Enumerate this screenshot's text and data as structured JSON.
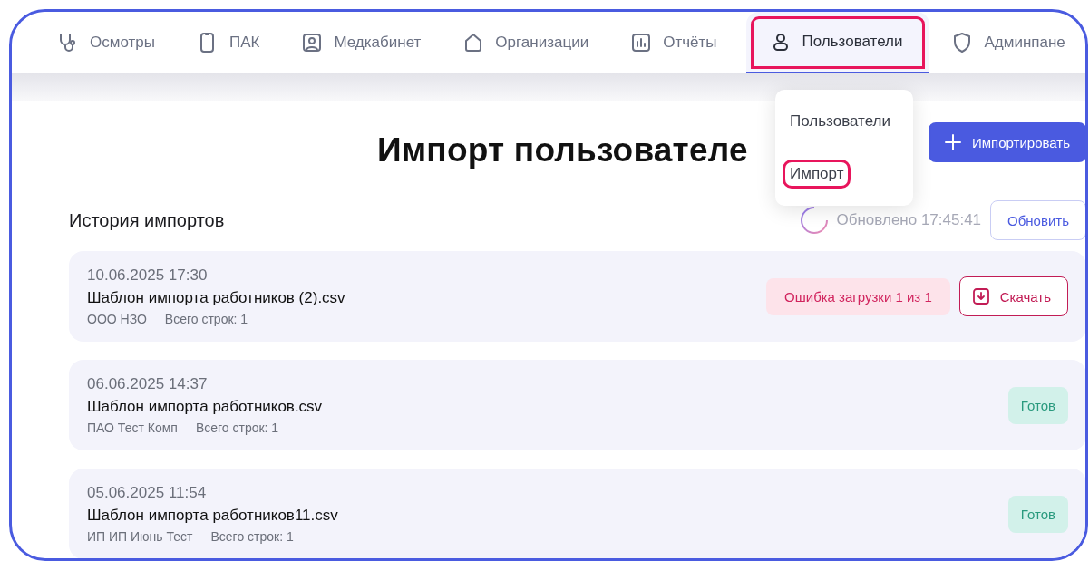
{
  "nav": {
    "items": [
      {
        "label": "Осмотры",
        "kind": "stethoscope",
        "selected": false,
        "highlighted": false
      },
      {
        "label": "ПАК",
        "kind": "device",
        "selected": false,
        "highlighted": false
      },
      {
        "label": "Медкабинет",
        "kind": "portrait",
        "selected": false,
        "highlighted": false
      },
      {
        "label": "Организации",
        "kind": "house",
        "selected": false,
        "highlighted": false
      },
      {
        "label": "Отчёты",
        "kind": "chart",
        "selected": false,
        "highlighted": false
      },
      {
        "label": "Пользователи",
        "kind": "user",
        "selected": true,
        "highlighted": true
      },
      {
        "label": "Админпане",
        "kind": "shield",
        "selected": false,
        "highlighted": false
      }
    ]
  },
  "dropdown": {
    "items": [
      {
        "label": "Пользователи",
        "highlighted": false
      },
      {
        "label": "Импорт",
        "highlighted": true
      }
    ]
  },
  "page": {
    "title": "Импорт пользователе",
    "import_button": "Импортировать",
    "history_title": "История импортов",
    "updated": "Обновлено 17:45:41",
    "refresh_button": "Обновить"
  },
  "imports": [
    {
      "date": "10.06.2025 17:30",
      "file": "Шаблон импорта работников (2).csv",
      "organization": "ООО НЗО",
      "rows": "Всего строк: 1",
      "status": {
        "kind": "error",
        "label": "Ошибка загрузки 1 из 1"
      },
      "download": "Скачать"
    },
    {
      "date": "06.06.2025 14:37",
      "file": "Шаблон импорта работников.csv",
      "organization": "ПАО Тест Комп",
      "rows": "Всего строк: 1",
      "status": {
        "kind": "done",
        "label": "Готов"
      }
    },
    {
      "date": "05.06.2025 11:54",
      "file": "Шаблон импорта работников11.csv",
      "organization": "ИП ИП Июнь Тест",
      "rows": "Всего строк: 1",
      "status": {
        "kind": "done",
        "label": "Готов"
      }
    }
  ]
}
